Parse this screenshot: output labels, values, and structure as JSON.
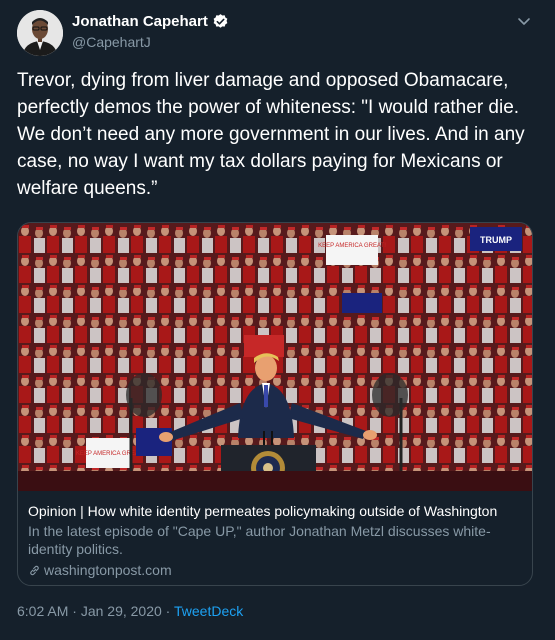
{
  "author": {
    "display_name": "Jonathan Capehart",
    "handle": "@CapehartJ"
  },
  "tweet": {
    "text": "Trevor, dying from liver damage and opposed Obamacare, perfectly demos the power of whiteness: \"I would rather die. We don’t need any more government in our lives. And in any case, no way I want my tax dollars paying for Mexicans or welfare queens.”"
  },
  "card": {
    "image_signs": [
      "KEEP AMERICA GREAT!",
      "TRUMP",
      "KEEP AMERICA GREAT"
    ],
    "title": "Opinion | How white identity permeates policymaking outside of Washington",
    "description": "In the latest episode of \"Cape UP,\" author Jonathan Metzl discusses white-identity politics.",
    "domain": "washingtonpost.com"
  },
  "meta": {
    "time": "6:02 AM",
    "separator": " · ",
    "date": "Jan 29, 2020",
    "source": "TweetDeck"
  },
  "colors": {
    "background": "#15202b",
    "secondary_text": "#8899a6",
    "link": "#1da1f2",
    "border": "#38444d"
  },
  "icons": [
    "verified-badge-icon",
    "chevron-down-icon",
    "link-icon"
  ]
}
